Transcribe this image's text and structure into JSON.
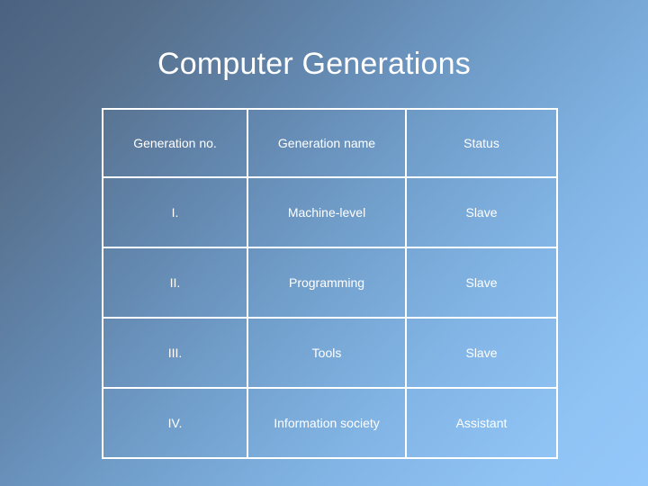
{
  "slide": {
    "title": "Computer Generations",
    "background": {
      "from": "#4b6380",
      "to": "#95c8fa"
    }
  },
  "table": {
    "name": "computer-generations-table",
    "columns": [
      {
        "key": "no",
        "label": "Generation no."
      },
      {
        "key": "name",
        "label": "Generation name"
      },
      {
        "key": "status",
        "label": "Status"
      }
    ],
    "rows": [
      {
        "no": "I.",
        "name": "Machine-level",
        "status": "Slave"
      },
      {
        "no": "II.",
        "name": "Programming",
        "status": "Slave"
      },
      {
        "no": "III.",
        "name": "Tools",
        "status": "Slave"
      },
      {
        "no": "IV.",
        "name": "Information society",
        "status": "Assistant"
      }
    ],
    "highlight": {
      "value": "Assistant",
      "color": "#cc0099"
    }
  }
}
